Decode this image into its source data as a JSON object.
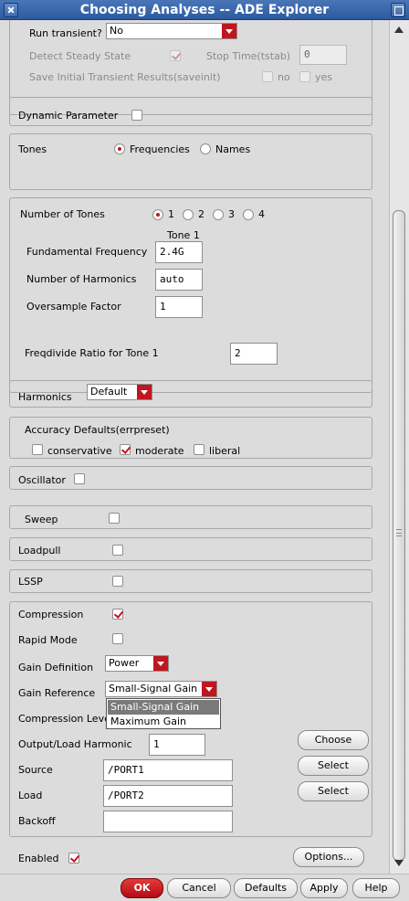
{
  "window": {
    "title": "Choosing Analyses -- ADE Explorer"
  },
  "transient": {
    "run_label": "Run transient?",
    "run_value": "No",
    "detect_label": "Detect Steady State",
    "stop_label": "Stop Time(tstab)",
    "stop_value": "0",
    "save_label": "Save Initial Transient Results(saveinit)",
    "no_label": "no",
    "yes_label": "yes"
  },
  "dynamic_parameter": {
    "label": "Dynamic Parameter"
  },
  "tones": {
    "label": "Tones",
    "frequencies_label": "Frequencies",
    "names_label": "Names"
  },
  "tone_settings": {
    "num_tones_label": "Number of Tones",
    "options": [
      "1",
      "2",
      "3",
      "4"
    ],
    "column_header": "Tone 1",
    "fund_freq_label": "Fundamental Frequency",
    "fund_freq_value": "2.4G",
    "num_harm_label": "Number of Harmonics",
    "num_harm_value": "auto",
    "oversample_label": "Oversample Factor",
    "oversample_value": "1",
    "freqdivide_label": "Freqdivide Ratio for Tone 1",
    "freqdivide_value": "2"
  },
  "harmonics": {
    "label": "Harmonics",
    "value": "Default"
  },
  "accuracy": {
    "label": "Accuracy Defaults(errpreset)",
    "conservative": "conservative",
    "moderate": "moderate",
    "liberal": "liberal"
  },
  "oscillator": {
    "label": "Oscillator"
  },
  "sweep": {
    "label": "Sweep"
  },
  "loadpull": {
    "label": "Loadpull"
  },
  "lssp": {
    "label": "LSSP"
  },
  "compression": {
    "label": "Compression",
    "rapid_label": "Rapid Mode",
    "gain_def_label": "Gain Definition",
    "gain_def_value": "Power",
    "gain_ref_label": "Gain Reference",
    "gain_ref_value": "Small-Signal Gain",
    "gain_ref_options": [
      "Small-Signal Gain",
      "Maximum Gain"
    ],
    "comp_level_label": "Compression Level",
    "output_harm_label": "Output/Load Harmonic",
    "output_harm_value": "1",
    "choose_label": "Choose",
    "source_label": "Source",
    "source_value": "/PORT1",
    "source_select": "Select",
    "load_label": "Load",
    "load_value": "/PORT2",
    "load_select": "Select",
    "backoff_label": "Backoff",
    "backoff_value": ""
  },
  "footer": {
    "enabled_label": "Enabled",
    "options_label": "Options...",
    "ok": "OK",
    "cancel": "Cancel",
    "defaults": "Defaults",
    "apply": "Apply",
    "help": "Help"
  },
  "colors": {
    "accent": "#c0161f",
    "title_bar": "#2c5aa0"
  }
}
